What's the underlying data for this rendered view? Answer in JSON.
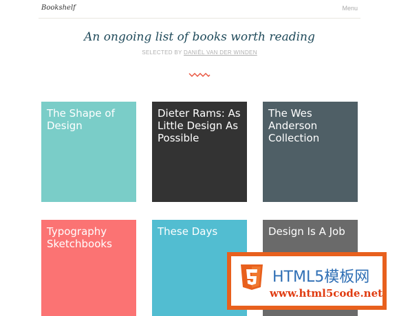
{
  "header": {
    "brand": "Bookshelf",
    "menu_label": "Menu"
  },
  "hero": {
    "title": "An ongoing list of books worth reading",
    "byline_prefix": "SELECTED BY ",
    "byline_author": "DANIËL VAN DER WINDEN"
  },
  "books": [
    {
      "title": "The Shape of Design",
      "color": "#7acdc8"
    },
    {
      "title": "Dieter Rams: As Little Design As Possible",
      "color": "#333333"
    },
    {
      "title": "The Wes Anderson Collection",
      "color": "#4f5f66"
    },
    {
      "title": "Typography Sketchbooks",
      "color": "#fb7373"
    },
    {
      "title": "These Days",
      "color": "#52bdd1"
    },
    {
      "title": "Design Is A Job",
      "color": "#6a6a6a"
    }
  ],
  "watermark": {
    "line1": "HTML5模板网",
    "line2": "www.html5code.net",
    "icon": "html5-shield-icon"
  },
  "colors": {
    "accent_squiggle": "#e8503a",
    "title": "#1f4a5a"
  }
}
